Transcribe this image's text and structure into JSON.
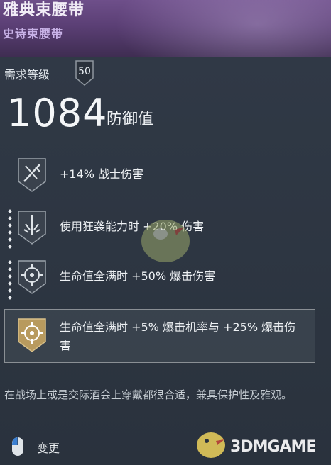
{
  "item": {
    "name": "雅典束腰带",
    "rarity": "史诗束腰带"
  },
  "requirement": {
    "label": "需求等级",
    "level": "50"
  },
  "defense": {
    "value": "1084",
    "label": "防御值"
  },
  "perks": [
    {
      "text": "+14% 战士伤害",
      "icon": "crossed-swords-icon"
    },
    {
      "text": "使用狂袭能力时 +20% 伤害",
      "icon": "sword-burst-icon"
    },
    {
      "text": "生命值全满时 +50% 爆击伤害",
      "icon": "crosshair-icon"
    },
    {
      "text": "生命值全满时 +5% 爆击机率与 +25% 爆击伤害",
      "icon": "crosshair-gold-icon"
    }
  ],
  "flavor_text": "在战场上或是交际酒会上穿戴都很合适，兼具保护性及雅观。",
  "footer": {
    "action_label": "变更",
    "watermark": "3DMGAME"
  },
  "colors": {
    "header_purple": "#5b3f75",
    "rarity_text": "#c9b3e8",
    "panel_bg": "#2c3440",
    "gold_accent": "#b89a5e"
  }
}
